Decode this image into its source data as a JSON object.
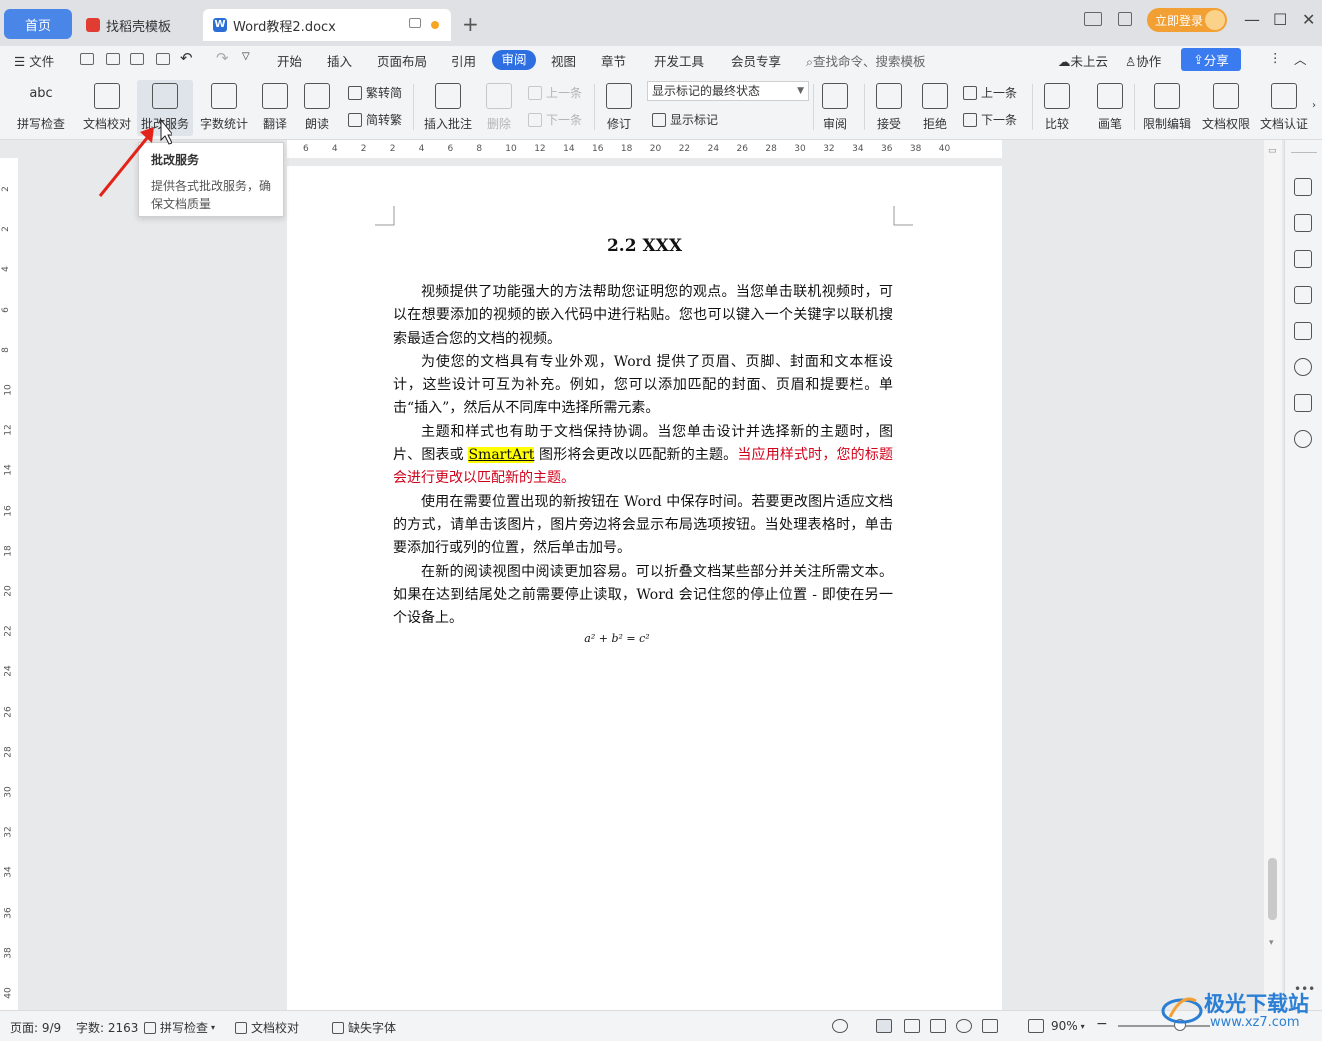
{
  "titlebar": {
    "tabs": [
      {
        "label": "首页"
      },
      {
        "label": "找稻壳模板"
      },
      {
        "label": "Word教程2.docx"
      }
    ],
    "login_label": "立即登录"
  },
  "menubar": {
    "file_label": "文件",
    "items": [
      "开始",
      "插入",
      "页面布局",
      "引用",
      "审阅",
      "视图",
      "章节",
      "开发工具",
      "会员专享"
    ],
    "active": "审阅",
    "search_placeholder": "查找命令、搜索模板",
    "cloud_label": "未上云",
    "collab_label": "协作",
    "share_label": "分享"
  },
  "ribbon": {
    "spellcheck": "拼写检查",
    "doc_proof": "文档校对",
    "correction_service": "批改服务",
    "word_count": "字数统计",
    "translate": "翻译",
    "read_aloud": "朗读",
    "to_traditional": "繁转简",
    "to_simplified": "简转繁",
    "insert_comment": "插入批注",
    "delete": "删除",
    "prev_comment": "上一条",
    "next_comment": "下一条",
    "track_changes": "修订",
    "markup_select": "显示标记的最终状态",
    "show_markup": "显示标记",
    "review_pane": "审阅",
    "accept": "接受",
    "reject": "拒绝",
    "prev_change": "上一条",
    "next_change": "下一条",
    "compare": "比较",
    "pen": "画笔",
    "restrict_edit": "限制编辑",
    "doc_permission": "文档权限",
    "doc_cert": "文档认证"
  },
  "tooltip": {
    "title": "批改服务",
    "desc": "提供各式批改服务，确保文档质量"
  },
  "ruler": {
    "h_ticks": [
      "6",
      "4",
      "2",
      "2",
      "4",
      "6",
      "8",
      "10",
      "12",
      "14",
      "16",
      "18",
      "20",
      "22",
      "24",
      "26",
      "28",
      "30",
      "32",
      "34",
      "36",
      "38",
      "40"
    ],
    "v_ticks": [
      "2",
      "2",
      "4",
      "6",
      "8",
      "10",
      "12",
      "14",
      "16",
      "18",
      "20",
      "22",
      "24",
      "26",
      "28",
      "30",
      "32",
      "34",
      "36",
      "38",
      "40"
    ]
  },
  "document": {
    "heading": "2.2 XXX",
    "p1": "视频提供了功能强大的方法帮助您证明您的观点。当您单击联机视频时，可以在想要添加的视频的嵌入代码中进行粘贴。您也可以键入一个关键字以联机搜索最适合您的文档的视频。",
    "p2": "为使您的文档具有专业外观，Word 提供了页眉、页脚、封面和文本框设计，这些设计可互为补充。例如，您可以添加匹配的封面、页眉和提要栏。单击“插入”，然后从不同库中选择所需元素。",
    "p3_a": "主题和样式也有助于文档保持协调。当您单击设计并选择新的主题时，图片、图表或 ",
    "p3_hl": "SmartArt",
    "p3_b": " 图形将会更改以匹配新的主题。",
    "p3_red": "当应用样式时，您的标题会进行更改以匹配新的主题。",
    "p4": "使用在需要位置出现的新按钮在 Word 中保存时间。若要更改图片适应文档的方式，请单击该图片，图片旁边将会显示布局选项按钮。当处理表格时，单击要添加行或列的位置，然后单击加号。",
    "p5": "在新的阅读视图中阅读更加容易。可以折叠文档某些部分并关注所需文本。如果在达到结尾处之前需要停止读取，Word 会记住您的停止位置 - 即使在另一个设备上。",
    "formula": "a² + b² = c²"
  },
  "statusbar": {
    "page": "页面: 9/9",
    "wordcount": "字数: 2163",
    "spell": "拼写检查",
    "proof": "文档校对",
    "missing_font": "缺失字体",
    "zoom": "90%"
  },
  "watermark": {
    "title": "极光下载站",
    "url": "www.xz7.com"
  },
  "colors": {
    "accent": "#2d6ee0",
    "login": "#f2a033",
    "tracked_red": "#d0021b",
    "highlight": "#ffff00"
  }
}
